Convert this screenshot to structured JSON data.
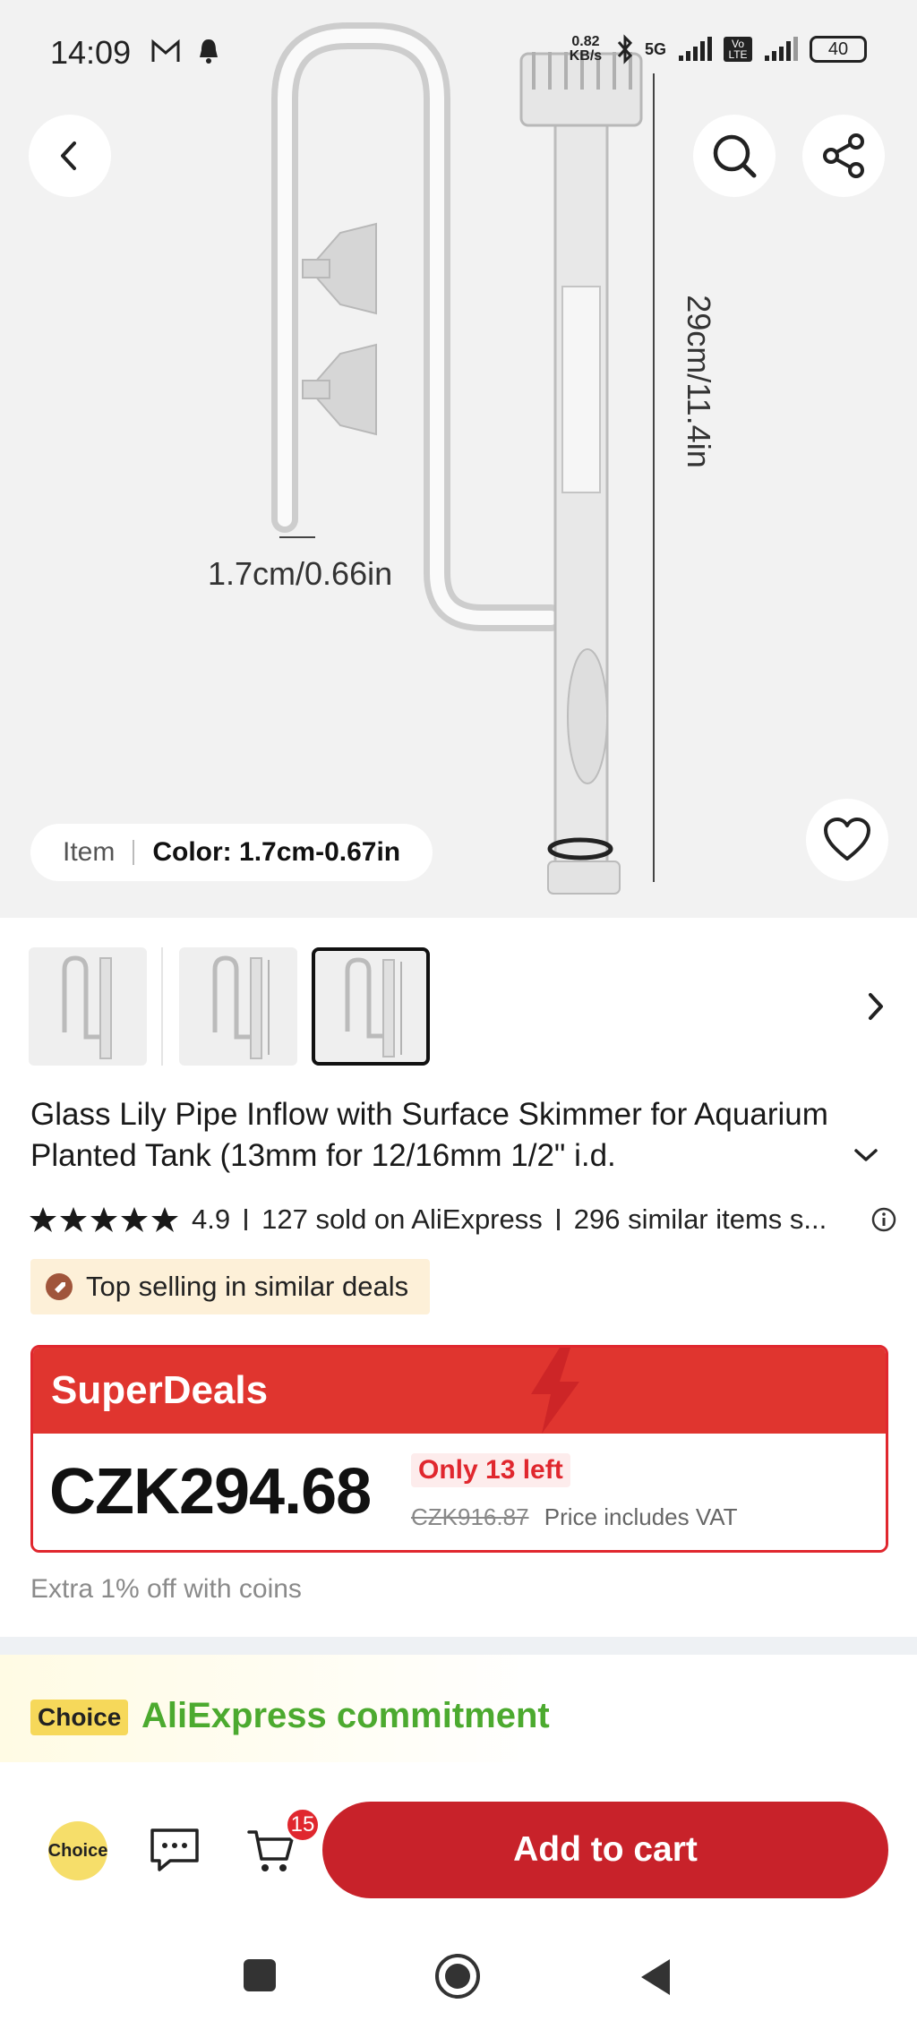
{
  "status_bar": {
    "time": "14:09",
    "net_speed": "0.82 KB/s",
    "network": "5G",
    "volte": "Vo LTE",
    "battery": "40"
  },
  "hero": {
    "dimension_width": "1.7cm/0.66in",
    "dimension_height": "29cm/11.4in",
    "variant": {
      "item_label": "Item",
      "color_label": "Color: 1.7cm-0.67in"
    }
  },
  "icons": {
    "back": "chevron-left-icon",
    "search": "search-icon",
    "share": "share-icon",
    "favorite": "heart-icon",
    "next": "chevron-right-icon",
    "expand": "chevron-down-icon",
    "info": "info-icon",
    "chat": "chat-icon",
    "cart": "cart-icon"
  },
  "product": {
    "title": "Glass Lily Pipe Inflow with Surface Skimmer for Aquarium Planted Tank (13mm for 12/16mm 1/2\" i.d.",
    "rating": "4.9",
    "stars": 5,
    "sold": "127 sold on AliExpress",
    "similar": "296 similar items s...",
    "badge": "Top selling in similar deals"
  },
  "deal": {
    "heading": "SuperDeals",
    "price": "CZK294.68",
    "stock": "Only 13 left",
    "old_price": "CZK916.87",
    "vat_note": "Price includes VAT",
    "coins_note": "Extra 1% off with coins"
  },
  "commitment": {
    "choice_tag": "Choice",
    "text": "AliExpress commitment"
  },
  "action_bar": {
    "choice_label": "Choice",
    "cart_count": "15",
    "add_to_cart": "Add to cart"
  },
  "colors": {
    "brand_red": "#e0272e",
    "button_red": "#c8222a",
    "commit_green": "#4caa2f",
    "choice_yellow": "#f6d85a"
  }
}
